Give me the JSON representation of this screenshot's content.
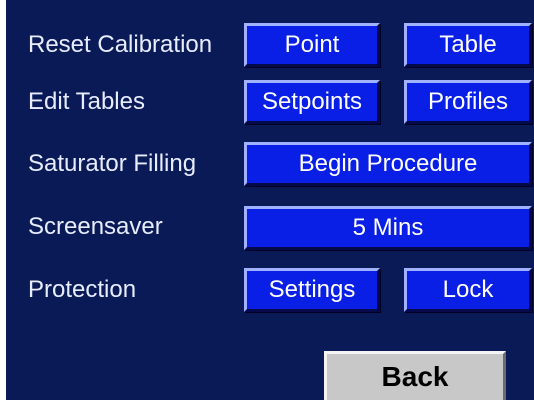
{
  "rows": [
    {
      "label": "Reset Calibration",
      "buttons": [
        "Point",
        "Table"
      ]
    },
    {
      "label": "Edit Tables",
      "buttons": [
        "Setpoints",
        "Profiles"
      ]
    },
    {
      "label": "Saturator Filling",
      "buttons": [
        "Begin Procedure"
      ]
    },
    {
      "label": "Screensaver",
      "buttons": [
        "5 Mins"
      ]
    },
    {
      "label": "Protection",
      "buttons": [
        "Settings",
        "Lock"
      ]
    }
  ],
  "footer": {
    "back_label": "Back"
  },
  "colors": {
    "background": "#0a1a57",
    "button_blue": "#0a1fe6",
    "button_gray": "#c8c8c8",
    "text": "#ffffff"
  }
}
